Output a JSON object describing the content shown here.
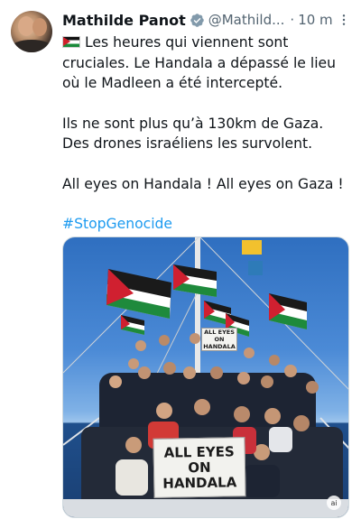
{
  "author": {
    "name": "Mathilde Panot",
    "handle": "@Mathild...",
    "separator": "·",
    "timestamp": "10 m",
    "verified": true
  },
  "post": {
    "flag_icon": "palestine-flag-emoji",
    "line1": "Les heures qui viennent sont cruciales. Le Handala a dépassé le lieu où le Madleen a été intercepté.",
    "line2": "Ils ne sont plus qu’à 130km de Gaza. Des drones israéliens les survolent.",
    "line3": "All eyes on Handala ! All eyes on Gaza !",
    "hashtag": "#StopGenocide"
  },
  "media": {
    "big_sign_line1": "ALL EYES",
    "big_sign_line2": "ON",
    "big_sign_line3": "HANDALA",
    "small_sign_line1": "ALL EYES ON",
    "small_sign_line2": "HANDALA",
    "watermark": "ai"
  },
  "colors": {
    "link": "#1d9bf0",
    "secondary_text": "#536471",
    "verified": "#829aab"
  },
  "icons": {
    "more": "more-options-icon",
    "verified": "verified-badge-icon"
  }
}
